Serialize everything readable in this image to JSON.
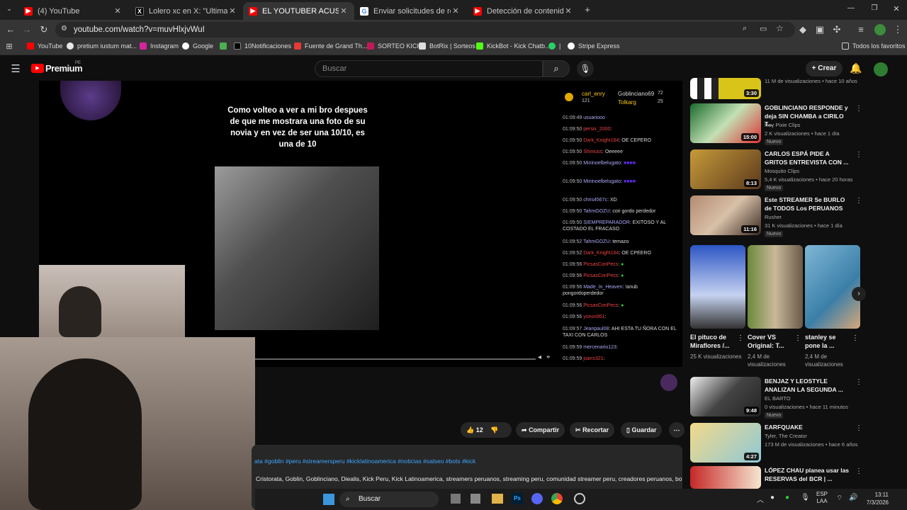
{
  "browser": {
    "tabs": [
      {
        "title": "(4) YouTube",
        "color": "#ff0000"
      },
      {
        "title": "Lolero xc en X: \"Ultimamente el",
        "color": "#000000"
      },
      {
        "title": "EL YOUTUBER ACUSADO DE LO",
        "color": "#ff0000"
      },
      {
        "title": "Enviar solicitudes de retirada p",
        "color": "#4285f4"
      },
      {
        "title": "Detección de contenido - YouT",
        "color": "#ff0000"
      }
    ],
    "url": "youtube.com/watch?v=muvHlxjvWuI",
    "bookmarks": [
      "YouTube",
      "pretium iustum mat...",
      "Instagram",
      "Google",
      "",
      "10Notificaciones",
      "Fuente de Grand Th...",
      "SORTEO KICK",
      "BotRix | Sorteos",
      "KickBot - Kick Chatb...",
      "|",
      "Stripe Express"
    ],
    "bookmarks_folder": "Todos los favoritos"
  },
  "youtube": {
    "logo": "Premium",
    "region": "PE",
    "search_placeholder": "Buscar",
    "create_label": "Crear"
  },
  "video": {
    "meme_text": "Como volteo a ver a mi bro despues de que me mostrara una foto de su novia y en vez de ser una 10/10, es una de 10",
    "chat_header": {
      "user1": "carl_enry",
      "num1": "121",
      "user2": "Goblinciano69",
      "num2": "72",
      "user3": "Tolkarg",
      "num3": "25"
    },
    "chat": [
      {
        "time": "01:09:49",
        "user": "usuariooo",
        "msg": ""
      },
      {
        "time": "01:09:50",
        "user": "persix_2000",
        "msg": ""
      },
      {
        "time": "01:09:50",
        "user": "Dark_Knight164",
        "msg": "OE CEPERO"
      },
      {
        "time": "01:09:50",
        "user": "Shimuss",
        "msg": "Oeeeee"
      },
      {
        "time": "01:09:50",
        "user": "Mininoelbelugato",
        "msg": ""
      },
      {
        "time": "01:09:50",
        "user": "Mininoelbelugato",
        "msg": ""
      },
      {
        "time": "01:09:50",
        "user": "chris4567c",
        "msg": "XD"
      },
      {
        "time": "01:09:50",
        "user": "TahmGOZU",
        "msg": "cori gordo perdedor"
      },
      {
        "time": "01:09:50",
        "user": "SIEMPREPARADOR",
        "msg": "EXITOSO Y AL COSTADO EL FRACASO"
      },
      {
        "time": "01:09:52",
        "user": "TahmGOZU",
        "msg": "temazo"
      },
      {
        "time": "01:09:52",
        "user": "Dark_Knight164",
        "msg": "OE CPEERO"
      },
      {
        "time": "01:09:56",
        "user": "PicsasConPecs",
        "msg": ""
      },
      {
        "time": "01:09:56",
        "user": "PicsasConPecs",
        "msg": ""
      },
      {
        "time": "01:09:56",
        "user": "Made_In_Heaven",
        "msg": "!anub pongordoperdedor"
      },
      {
        "time": "01:09:56",
        "user": "PicsasConPecs",
        "msg": ""
      },
      {
        "time": "01:09:56",
        "user": "yonos951",
        "msg": ""
      },
      {
        "time": "01:09:57",
        "user": "Jeanpaul08",
        "msg": "AHI ESTA TU ÑORA CON EL TAXI CON CARLOS"
      },
      {
        "time": "01:09:59",
        "user": "mercenario123",
        "msg": ""
      },
      {
        "time": "01:09:59",
        "user": "juans321",
        "msg": ""
      }
    ]
  },
  "actions": {
    "likes": "12",
    "share": "Compartir",
    "clip": "Recortar",
    "save": "Guardar"
  },
  "description": {
    "tags": "ata #goblin #peru #streamersperu #kicklatinoamerica #noticias #salseo #bots #kick",
    "keywords": "Cristorata, Goblin, Goblinciano, Diealis, Kick Peru, Kick Latinoamerica, streamers peruanos, streaming peru, comunidad streamer peru, creadores peruanos, bots"
  },
  "recommendations": [
    {
      "title": "",
      "channel": "",
      "meta": "11 M de visualizaciones • hace 10 años",
      "duration": "3:30",
      "badge": ""
    },
    {
      "title": "GOBLINCIANO RESPONDE y deja SIN CHAMBA a CIRILO T...",
      "channel": "Rey Pixie Clips",
      "meta": "2 K visualizaciones • hace 1 día",
      "duration": "15:00",
      "badge": "Nuevo"
    },
    {
      "title": "CARLOS ESPÁ PIDE A GRITOS ENTREVISTA CON ...",
      "channel": "Mosquito Clips",
      "meta": "5,4 K visualizaciones • hace 20 horas",
      "duration": "8:13",
      "badge": "Nuevo"
    },
    {
      "title": "Este STREAMER Se BURLO de TODOS Los PERUANOS",
      "channel": "Rusher",
      "meta": "31 K visualizaciones • hace 1 día",
      "duration": "11:16",
      "badge": "Nuevo"
    },
    {
      "title": "BENJAZ Y LEOSTYLE ANALIZAN LA SEGUNDA ...",
      "channel": "EL BARTO",
      "meta": "0 visualizaciones • hace 11 minutos",
      "duration": "9:48",
      "badge": "Nuevo"
    },
    {
      "title": "EARFQUAKE",
      "channel": "Tyler, The Creator",
      "meta": "173 M de visualizaciones • hace 6 años",
      "duration": "4:27",
      "badge": ""
    },
    {
      "title": "LÓPEZ CHAU planea usar las RESERVAS del BCR | ...",
      "channel": "",
      "meta": "",
      "duration": "",
      "badge": ""
    }
  ],
  "shorts": [
    {
      "title": "El pituco de Miraflores /...",
      "views": "25 K visualizaciones"
    },
    {
      "title": "Cover VS Original: T...",
      "views": "2,4 M de visualizaciones"
    },
    {
      "title": "stanley se pone la ...",
      "views": "2,4 M de visualizaciones"
    }
  ],
  "taskbar": {
    "search": "Buscar",
    "lang1": "ESP",
    "lang2": "LAA",
    "time": "13:11",
    "date": "7/3/2026"
  }
}
